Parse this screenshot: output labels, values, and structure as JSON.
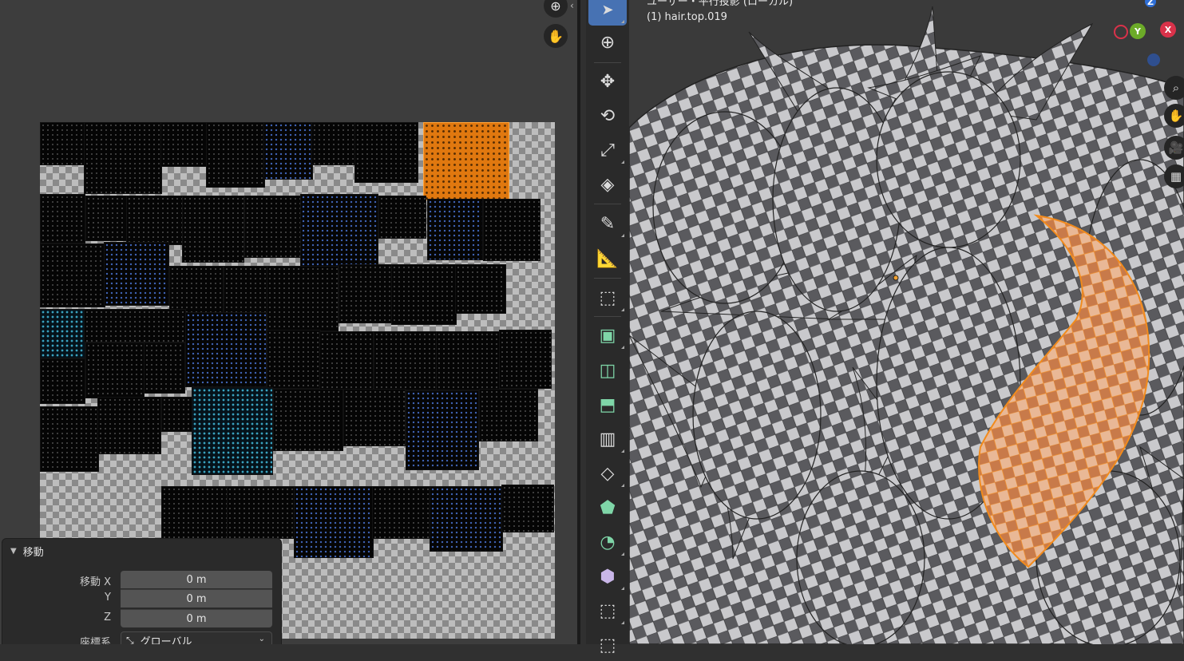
{
  "viewport": {
    "title": "ユーザー・平行投影 (ローカル)",
    "object_name": "(1) hair.top.019",
    "gizmo": {
      "x_label": "X",
      "y_label": "Y",
      "z_label": "Z",
      "x_color": "#d9324a",
      "y_color": "#6cab28",
      "z_color": "#2f6fd6"
    }
  },
  "operator_panel": {
    "title": "移動",
    "move_x_label": "移動 X",
    "move_x_value": "0 m",
    "y_label": "Y",
    "y_value": "0 m",
    "z_label": "Z",
    "z_value": "0 m",
    "orientation_label": "座標系",
    "orientation_value": "グローバル"
  },
  "toolbar": {
    "tools": [
      "select-box",
      "cursor",
      "move",
      "rotate",
      "scale",
      "transform",
      "annotate",
      "measure",
      "add-cube",
      "extrude",
      "inset",
      "bevel",
      "loop-cut",
      "knife",
      "poly-build",
      "spin",
      "smooth",
      "shear"
    ],
    "active_tool": "select-box"
  },
  "colors": {
    "selection_orange": "#e0780f",
    "active_tool_blue": "#4772b3"
  }
}
